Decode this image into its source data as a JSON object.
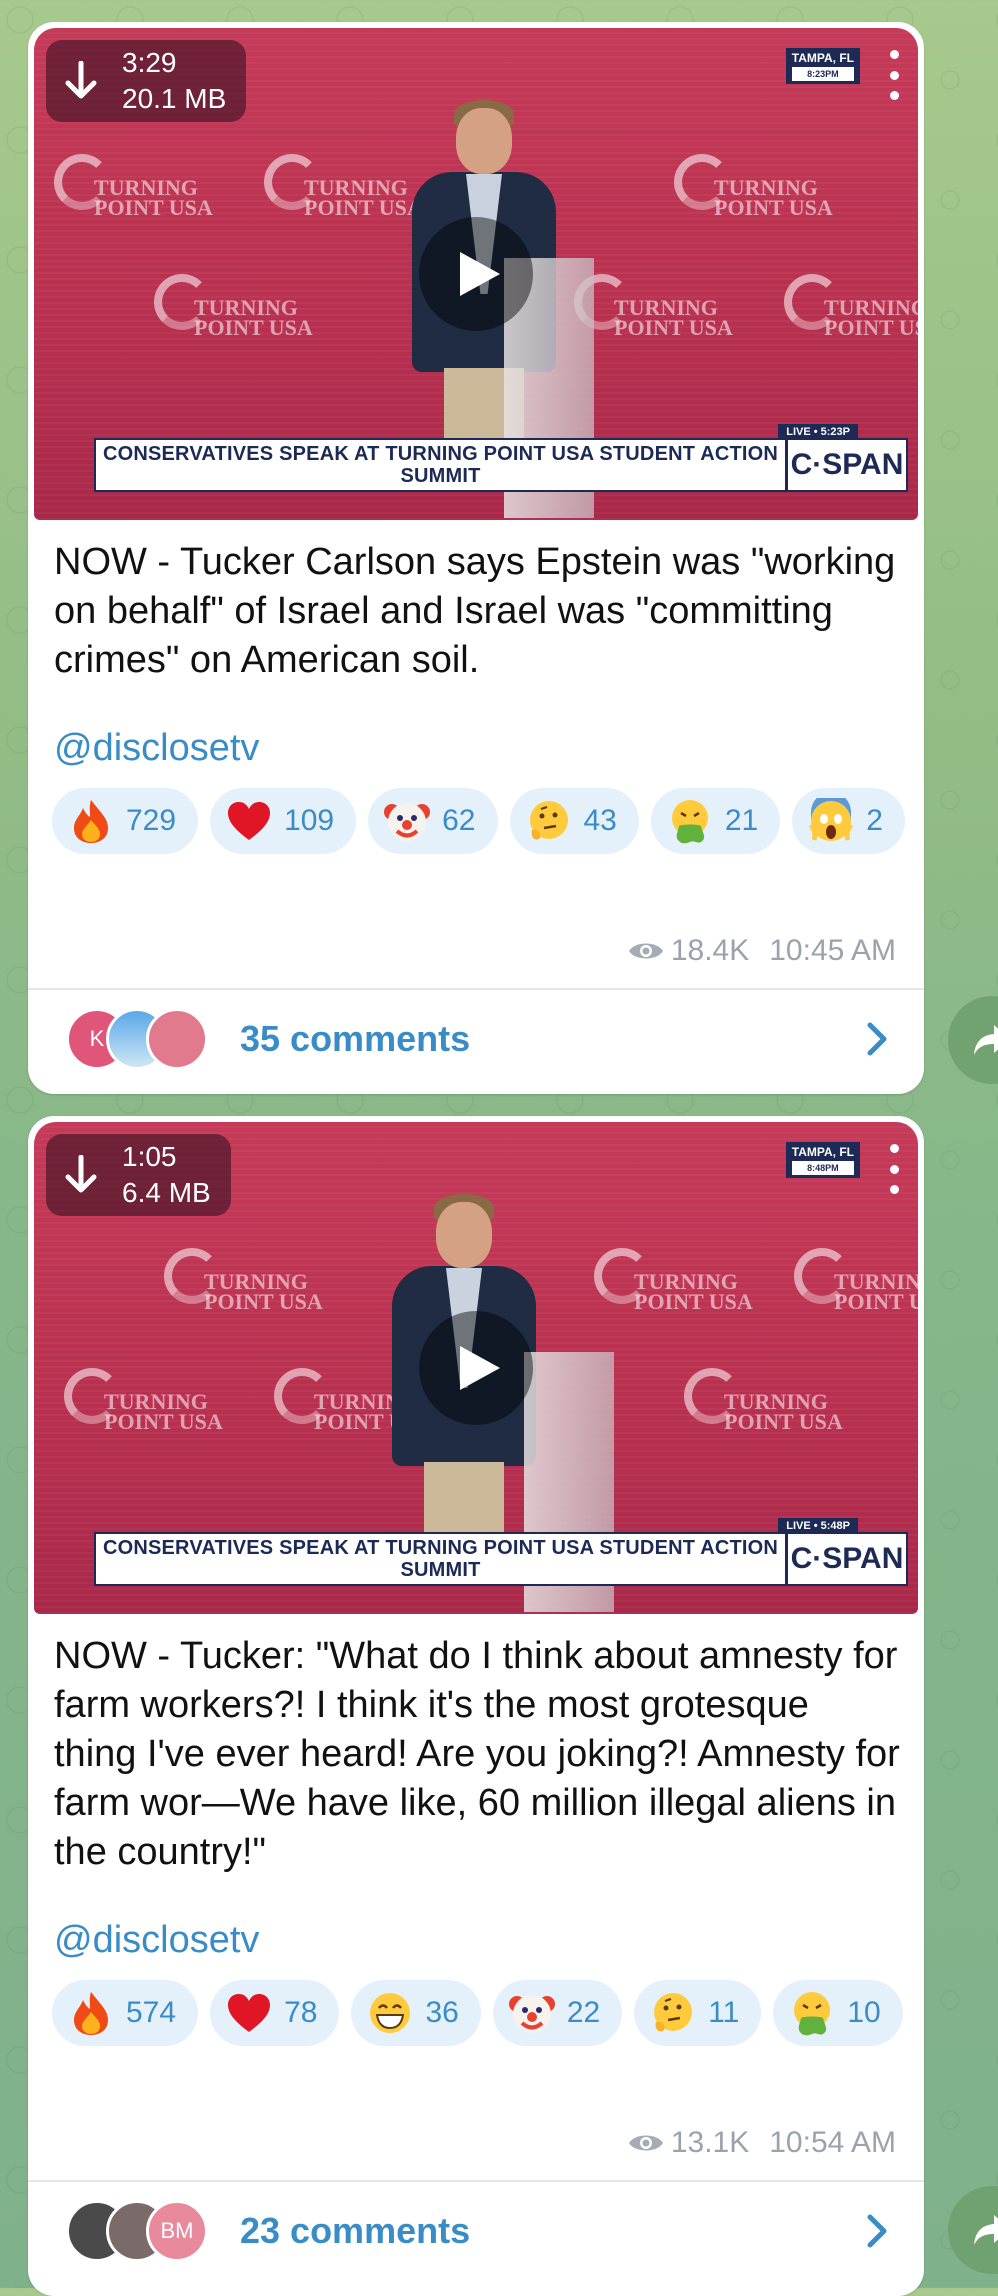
{
  "posts": [
    {
      "download": {
        "duration": "3:29",
        "size": "20.1 MB"
      },
      "video": {
        "lower_third": "CONSERVATIVES SPEAK AT TURNING POINT USA STUDENT ACTION SUMMIT",
        "network": "C·SPAN",
        "location": "TAMPA, FL",
        "clock": "8:23PM",
        "live": "LIVE • 5:23P",
        "backdrop_logo": "TURNING POINT USA"
      },
      "text": "NOW - Tucker Carlson says Epstein was \"working on behalf\" of Israel and Israel was \"committing crimes\" on American soil.",
      "handle": "@disclosetv",
      "reactions": [
        {
          "emoji": "fire",
          "count": "729"
        },
        {
          "emoji": "heart",
          "count": "109"
        },
        {
          "emoji": "clown",
          "count": "62"
        },
        {
          "emoji": "thinking",
          "count": "43"
        },
        {
          "emoji": "vomit",
          "count": "21"
        },
        {
          "emoji": "scream",
          "count": "2"
        }
      ],
      "views": "18.4K",
      "time": "10:45 AM",
      "comments": {
        "label": "35 comments",
        "avatars": [
          "K",
          "",
          ""
        ]
      }
    },
    {
      "download": {
        "duration": "1:05",
        "size": "6.4 MB"
      },
      "video": {
        "lower_third": "CONSERVATIVES SPEAK AT TURNING POINT USA STUDENT ACTION SUMMIT",
        "network": "C·SPAN",
        "location": "TAMPA, FL",
        "clock": "8:48PM",
        "live": "LIVE • 5:48P",
        "backdrop_logo": "TURNING POINT USA"
      },
      "text": "NOW - Tucker: \"What do I think about amnesty for farm workers?! I think it's the most grotesque thing I've ever heard! Are you joking?! Amnesty for farm wor—We have like, 60 million illegal aliens in the country!\"",
      "handle": "@disclosetv",
      "reactions": [
        {
          "emoji": "fire",
          "count": "574"
        },
        {
          "emoji": "heart",
          "count": "78"
        },
        {
          "emoji": "grin",
          "count": "36"
        },
        {
          "emoji": "clown",
          "count": "22"
        },
        {
          "emoji": "thinking",
          "count": "11"
        },
        {
          "emoji": "vomit",
          "count": "10"
        }
      ],
      "views": "13.1K",
      "time": "10:54 AM",
      "comments": {
        "label": "23 comments",
        "avatars": [
          "",
          "",
          "BM"
        ]
      }
    }
  ],
  "colors": {
    "accent": "#3a8cc6",
    "reaction_bg": "#e4f1fb",
    "meta": "#9aa3ab",
    "video_bg": "#c53a58"
  },
  "icons": [
    "download-arrow-icon",
    "play-icon",
    "menu-dots-icon",
    "eye-icon",
    "chevron-right-icon",
    "share-icon"
  ]
}
